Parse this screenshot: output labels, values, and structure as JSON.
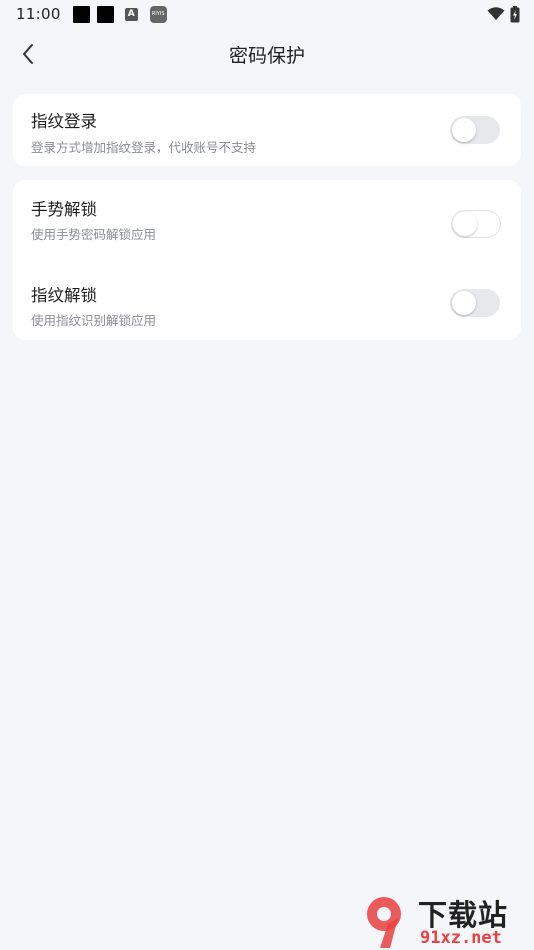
{
  "status_bar": {
    "time": "11:00",
    "notification_icons": [
      "square-icon",
      "square-icon",
      "a-badge-icon",
      "app-icon"
    ],
    "a_badge": "A",
    "app_icon_text": "RIYIS",
    "right_icons": [
      "wifi-icon",
      "battery-charging-icon"
    ]
  },
  "header": {
    "title": "密码保护",
    "back_icon": "chevron-left-icon"
  },
  "sections": [
    {
      "items": [
        {
          "title": "指纹登录",
          "subtitle": "登录方式增加指纹登录，代收账号不支持",
          "enabled": false
        }
      ]
    },
    {
      "items": [
        {
          "title": "手势解锁",
          "subtitle": "使用手势密码解锁应用",
          "enabled": false
        },
        {
          "title": "指纹解锁",
          "subtitle": "使用指纹识别解锁应用",
          "enabled": false
        }
      ]
    }
  ],
  "watermark": {
    "text_top": "下载站",
    "text_bottom": "91xz.net",
    "logo_text": "9",
    "brand_color": "#e8413f"
  },
  "colors": {
    "background": "#f5f6fa",
    "card": "#ffffff",
    "toggle_off": "#e6e8ec",
    "subtitle": "#8a8d93"
  }
}
